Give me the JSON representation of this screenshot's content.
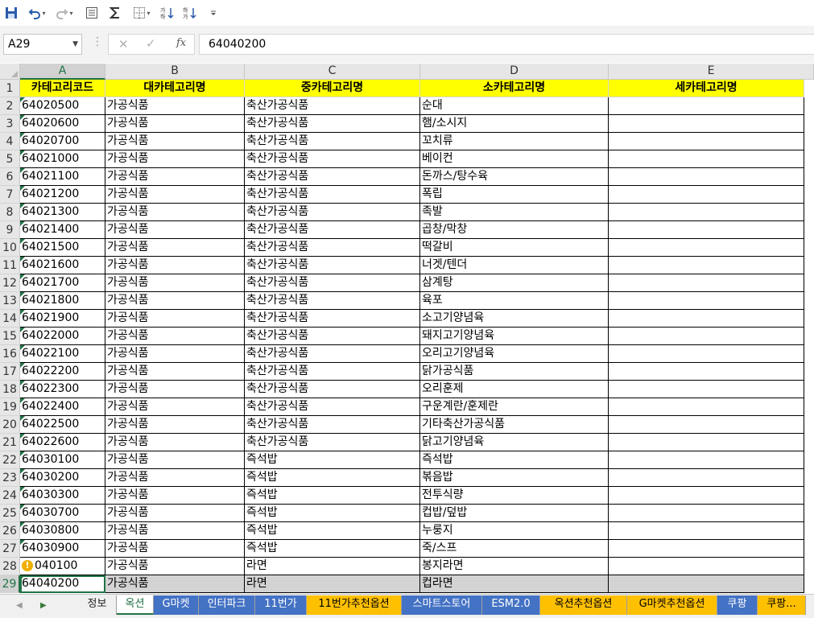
{
  "toolbar": {
    "items": [
      "save-icon",
      "undo-icon",
      "redo-icon",
      "form-icon",
      "autosum-icon",
      "border-icon",
      "sort-asc-icon",
      "sort-desc-icon",
      "customize-icon"
    ]
  },
  "formula_bar": {
    "name_box": "A29",
    "fx_label": "fx",
    "formula": "64040200"
  },
  "columns": [
    "A",
    "B",
    "C",
    "D",
    "E"
  ],
  "selected_column": "A",
  "rows": [
    {
      "n": "1",
      "cells": [
        "카테고리코드",
        "대카테고리명",
        "중카테고리명",
        "소카테고리명",
        "세카테고리명"
      ]
    },
    {
      "n": "2",
      "cells": [
        "64020500",
        "가공식품",
        "축산가공식품",
        "순대",
        ""
      ]
    },
    {
      "n": "3",
      "cells": [
        "64020600",
        "가공식품",
        "축산가공식품",
        "햄/소시지",
        ""
      ]
    },
    {
      "n": "4",
      "cells": [
        "64020700",
        "가공식품",
        "축산가공식품",
        "꼬치류",
        ""
      ]
    },
    {
      "n": "5",
      "cells": [
        "64021000",
        "가공식품",
        "축산가공식품",
        "베이컨",
        ""
      ]
    },
    {
      "n": "6",
      "cells": [
        "64021100",
        "가공식품",
        "축산가공식품",
        "돈까스/탕수육",
        ""
      ]
    },
    {
      "n": "7",
      "cells": [
        "64021200",
        "가공식품",
        "축산가공식품",
        "폭립",
        ""
      ]
    },
    {
      "n": "8",
      "cells": [
        "64021300",
        "가공식품",
        "축산가공식품",
        "족발",
        ""
      ]
    },
    {
      "n": "9",
      "cells": [
        "64021400",
        "가공식품",
        "축산가공식품",
        "곱창/막창",
        ""
      ]
    },
    {
      "n": "10",
      "cells": [
        "64021500",
        "가공식품",
        "축산가공식품",
        "떡갈비",
        ""
      ]
    },
    {
      "n": "11",
      "cells": [
        "64021600",
        "가공식품",
        "축산가공식품",
        "너겟/텐더",
        ""
      ]
    },
    {
      "n": "12",
      "cells": [
        "64021700",
        "가공식품",
        "축산가공식품",
        "삼계탕",
        ""
      ]
    },
    {
      "n": "13",
      "cells": [
        "64021800",
        "가공식품",
        "축산가공식품",
        "육포",
        ""
      ]
    },
    {
      "n": "14",
      "cells": [
        "64021900",
        "가공식품",
        "축산가공식품",
        "소고기양념육",
        ""
      ]
    },
    {
      "n": "15",
      "cells": [
        "64022000",
        "가공식품",
        "축산가공식품",
        "돼지고기양념육",
        ""
      ]
    },
    {
      "n": "16",
      "cells": [
        "64022100",
        "가공식품",
        "축산가공식품",
        "오리고기양념육",
        ""
      ]
    },
    {
      "n": "17",
      "cells": [
        "64022200",
        "가공식품",
        "축산가공식품",
        "닭가공식품",
        ""
      ]
    },
    {
      "n": "18",
      "cells": [
        "64022300",
        "가공식품",
        "축산가공식품",
        "오리훈제",
        ""
      ]
    },
    {
      "n": "19",
      "cells": [
        "64022400",
        "가공식품",
        "축산가공식품",
        "구운계란/훈제란",
        ""
      ]
    },
    {
      "n": "20",
      "cells": [
        "64022500",
        "가공식품",
        "축산가공식품",
        "기타축산가공식품",
        ""
      ]
    },
    {
      "n": "21",
      "cells": [
        "64022600",
        "가공식품",
        "축산가공식품",
        "닭고기양념육",
        ""
      ]
    },
    {
      "n": "22",
      "cells": [
        "64030100",
        "가공식품",
        "즉석밥",
        "즉석밥",
        ""
      ]
    },
    {
      "n": "23",
      "cells": [
        "64030200",
        "가공식품",
        "즉석밥",
        "볶음밥",
        ""
      ]
    },
    {
      "n": "24",
      "cells": [
        "64030300",
        "가공식품",
        "즉석밥",
        "전투식량",
        ""
      ]
    },
    {
      "n": "25",
      "cells": [
        "64030700",
        "가공식품",
        "즉석밥",
        "컵밥/덮밥",
        ""
      ]
    },
    {
      "n": "26",
      "cells": [
        "64030800",
        "가공식품",
        "즉석밥",
        "누룽지",
        ""
      ]
    },
    {
      "n": "27",
      "cells": [
        "64030900",
        "가공식품",
        "즉석밥",
        "죽/스프",
        ""
      ]
    },
    {
      "n": "28",
      "cells": [
        "040100",
        "가공식품",
        "라면",
        "봉지라면",
        ""
      ]
    },
    {
      "n": "29",
      "cells": [
        "64040200",
        "가공식품",
        "라면",
        "컵라면",
        ""
      ]
    }
  ],
  "sheet_tabs": [
    {
      "label": "정보",
      "style": "plain"
    },
    {
      "label": "옥션",
      "style": "active"
    },
    {
      "label": "G마켓",
      "style": "blue"
    },
    {
      "label": "인터파크",
      "style": "blue"
    },
    {
      "label": "11번가",
      "style": "blue"
    },
    {
      "label": "11번가추천옵션",
      "style": "orange"
    },
    {
      "label": "스마트스토어",
      "style": "blue"
    },
    {
      "label": "ESM2.0",
      "style": "blue"
    },
    {
      "label": "옥션추천옵션",
      "style": "orange"
    },
    {
      "label": "G마켓추천옵션",
      "style": "orange"
    },
    {
      "label": "쿠팡",
      "style": "blue"
    },
    {
      "label": "쿠팡...",
      "style": "orange"
    }
  ],
  "colors": {
    "accent": "#217346",
    "header_fill": "#ffff00",
    "tab_blue": "#4472c4",
    "tab_orange": "#ffc000"
  }
}
